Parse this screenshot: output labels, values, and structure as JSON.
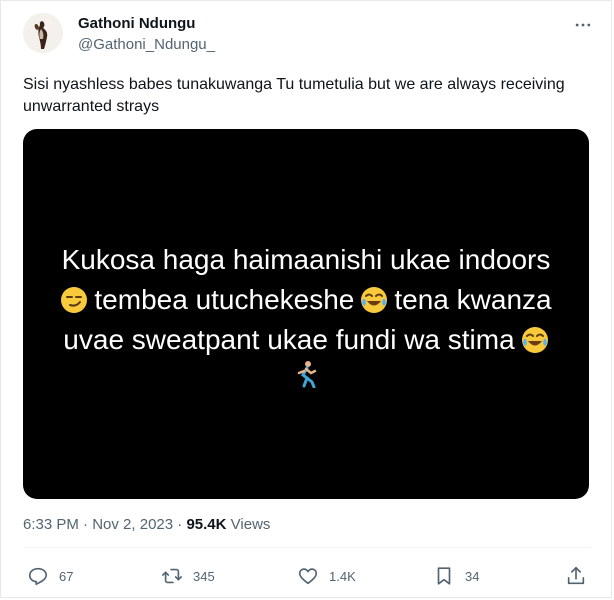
{
  "author": {
    "name": "Gathoni Ndungu",
    "handle": "@Gathoni_Ndungu_"
  },
  "tweet": {
    "text": "Sisi nyashless babes tunakuwanga Tu tumetulia but we are always receiving unwarranted strays"
  },
  "media": {
    "line1": "Kukosa haga haimaanishi ukae indoors",
    "line2_a": "tembea utuchekeshe",
    "line2_b": "tena kwanza",
    "line3": "uvae sweatpant ukae fundi wa stima"
  },
  "meta": {
    "time": "6:33 PM",
    "separator": "·",
    "date": "Nov 2, 2023",
    "views_count": "95.4K",
    "views_label": "Views"
  },
  "actions": {
    "replies": "67",
    "retweets": "345",
    "likes": "1.4K",
    "bookmarks": "34"
  },
  "icons": {
    "more": "more-icon",
    "reply": "reply-icon",
    "retweet": "retweet-icon",
    "like": "heart-icon",
    "bookmark": "bookmark-icon",
    "share": "share-icon"
  },
  "colors": {
    "text_primary": "#0f1419",
    "text_secondary": "#536471",
    "media_bg": "#000000"
  }
}
